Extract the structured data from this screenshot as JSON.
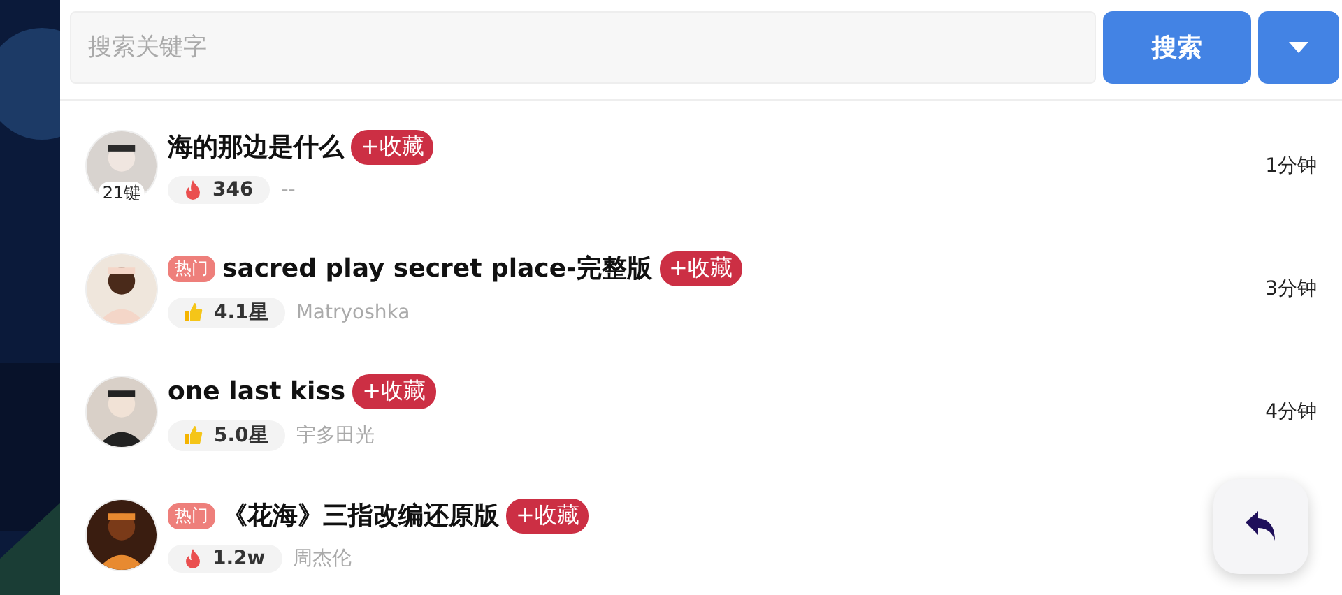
{
  "search": {
    "placeholder": "搜索关键字",
    "button": "搜索"
  },
  "songs": [
    {
      "title": "海的那边是什么",
      "avatar_badge": "21键",
      "kind": "flame",
      "stat": "346",
      "author": "--",
      "collect": "+收藏",
      "time": "1分钟"
    },
    {
      "title": "sacred play secret place-完整版",
      "hot_tag": "热门",
      "kind": "thumb",
      "stat": "4.1星",
      "author": "Matryoshka",
      "collect": "+收藏",
      "time": "3分钟"
    },
    {
      "title": "one last kiss",
      "kind": "thumb",
      "stat": "5.0星",
      "author": "宇多田光",
      "collect": "+收藏",
      "time": "4分钟"
    },
    {
      "title": "《花海》三指改编还原版",
      "hot_tag": "热门",
      "kind": "flame",
      "stat": "1.2w",
      "author": "周杰伦",
      "collect": "+收藏"
    }
  ]
}
